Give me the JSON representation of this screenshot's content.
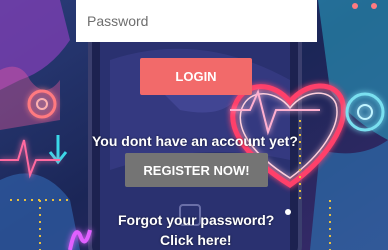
{
  "login_form": {
    "password_placeholder": "Password",
    "login_label": "LOGIN"
  },
  "register": {
    "prompt_text": "You dont have an account yet?",
    "button_label": "REGISTER NOW!"
  },
  "forgot": {
    "question_text": "Forgot your password?",
    "link_text": "Click here!"
  },
  "colors": {
    "login_button": "#f26a6a",
    "register_button": "#747474",
    "background": "#1b2a5c"
  }
}
